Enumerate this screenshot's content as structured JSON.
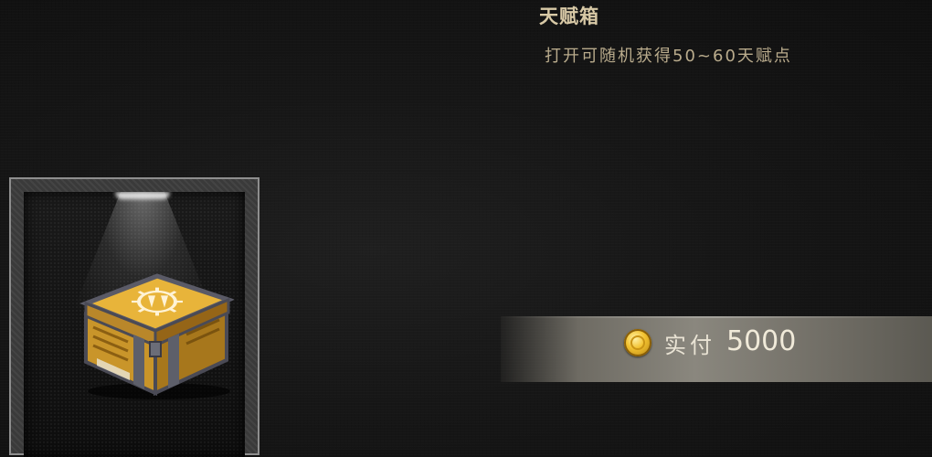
{
  "item": {
    "name": "天赋箱",
    "description": "打开可随机获得50~60天赋点",
    "icon": "talent-chest-icon"
  },
  "purchase": {
    "currency_icon": "gold-coin-icon",
    "label": "实付",
    "price": "5000"
  },
  "colors": {
    "background": "#151515",
    "title": "#d8c9a6",
    "description": "#b9ab8c",
    "price_bar": "#8a877e",
    "coin": "#f2c230"
  }
}
